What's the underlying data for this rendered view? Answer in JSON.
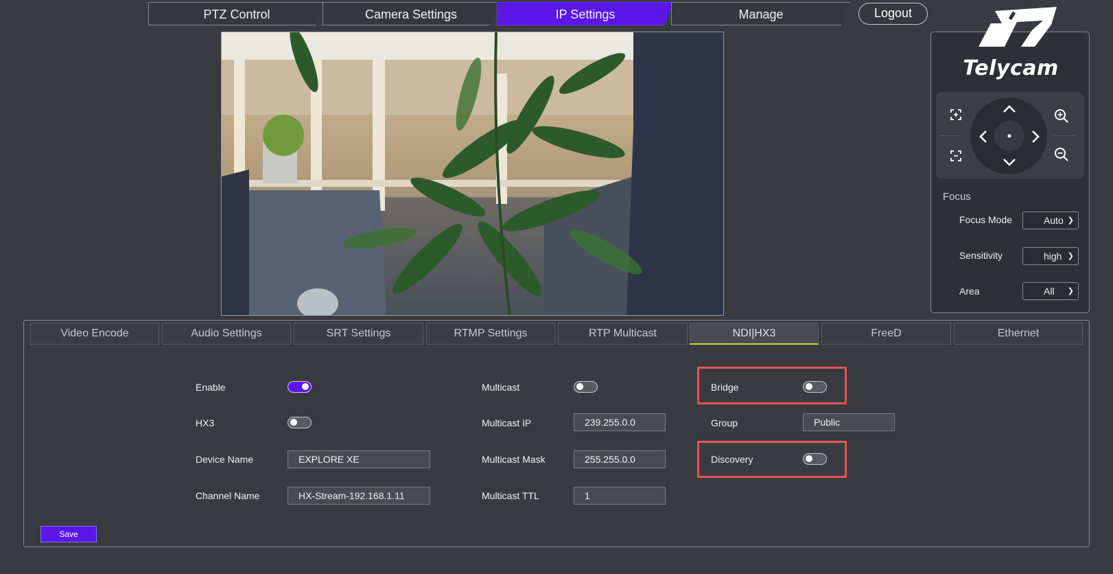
{
  "top_nav": {
    "tabs": [
      {
        "label": "PTZ Control",
        "active": false
      },
      {
        "label": "Camera Settings",
        "active": false
      },
      {
        "label": "IP Settings",
        "active": true
      },
      {
        "label": "Manage",
        "active": false
      }
    ],
    "logout_label": "Logout"
  },
  "logo": {
    "text": "Telycam",
    "icon": "telycam-logo-mark"
  },
  "ptz": {
    "icons": {
      "up": "chevron-up-icon",
      "down": "chevron-down-icon",
      "left": "chevron-left-icon",
      "right": "chevron-right-icon",
      "home": "center-dot-icon",
      "zoom_in": "zoom-in-icon",
      "zoom_out": "zoom-out-icon",
      "expand": "expand-frame-icon",
      "collapse": "collapse-frame-icon"
    }
  },
  "focus": {
    "heading": "Focus",
    "fields": [
      {
        "label": "Focus Mode",
        "value": "Auto"
      },
      {
        "label": "Sensitivity",
        "value": "high"
      },
      {
        "label": "Area",
        "value": "All"
      }
    ]
  },
  "sub_tabs": [
    {
      "label": "Video Encode",
      "active": false
    },
    {
      "label": "Audio Settings",
      "active": false
    },
    {
      "label": "SRT Settings",
      "active": false
    },
    {
      "label": "RTMP Settings",
      "active": false
    },
    {
      "label": "RTP Multicast",
      "active": false
    },
    {
      "label": "NDI|HX3",
      "active": true
    },
    {
      "label": "FreeD",
      "active": false
    },
    {
      "label": "Ethernet",
      "active": false
    }
  ],
  "ndi": {
    "enable": {
      "label": "Enable",
      "on": true
    },
    "hx3": {
      "label": "HX3",
      "on": false
    },
    "device_name": {
      "label": "Device Name",
      "value": "EXPLORE XE"
    },
    "channel_name": {
      "label": "Channel Name",
      "value": "HX-Stream-192.168.1.11"
    },
    "multicast": {
      "label": "Multicast",
      "on": false
    },
    "multicast_ip": {
      "label": "Multicast IP",
      "value": "239.255.0.0"
    },
    "multicast_mask": {
      "label": "Multicast Mask",
      "value": "255.255.0.0"
    },
    "multicast_ttl": {
      "label": "Multicast TTL",
      "value": "1"
    },
    "bridge": {
      "label": "Bridge",
      "on": false
    },
    "group": {
      "label": "Group",
      "value": "Public"
    },
    "discovery": {
      "label": "Discovery",
      "on": false
    }
  },
  "save_label": "Save",
  "colors": {
    "accent": "#5b17e8",
    "background": "#3a3b40",
    "highlight": "#e55651",
    "active_tab_underline": "#c8d64a"
  }
}
